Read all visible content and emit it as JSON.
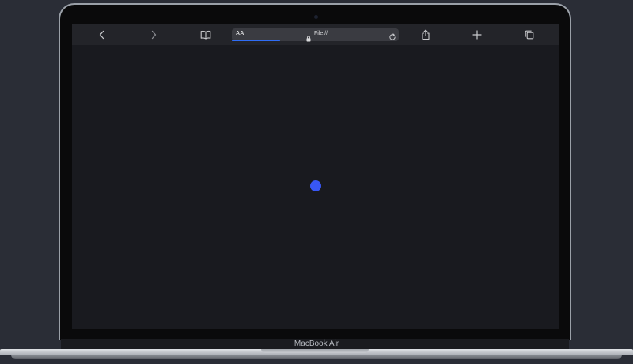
{
  "browser": {
    "toolbar": {
      "back_icon": "chevron-left-icon",
      "forward_icon": "chevron-right-icon",
      "bookmarks_icon": "book-icon",
      "share_icon": "share-icon",
      "new_tab_icon": "plus-icon",
      "tabs_icon": "tabs-icon"
    },
    "address_bar": {
      "reader_label": "AA",
      "url": "File://",
      "secure_icon": "lock-icon",
      "reload_icon": "reload-icon",
      "load_progress_percent": 29
    }
  },
  "page": {
    "content": "loading-dot",
    "dot_color": "#3857f5",
    "background_color": "#191a1f"
  },
  "device": {
    "label": "MacBook Air"
  }
}
